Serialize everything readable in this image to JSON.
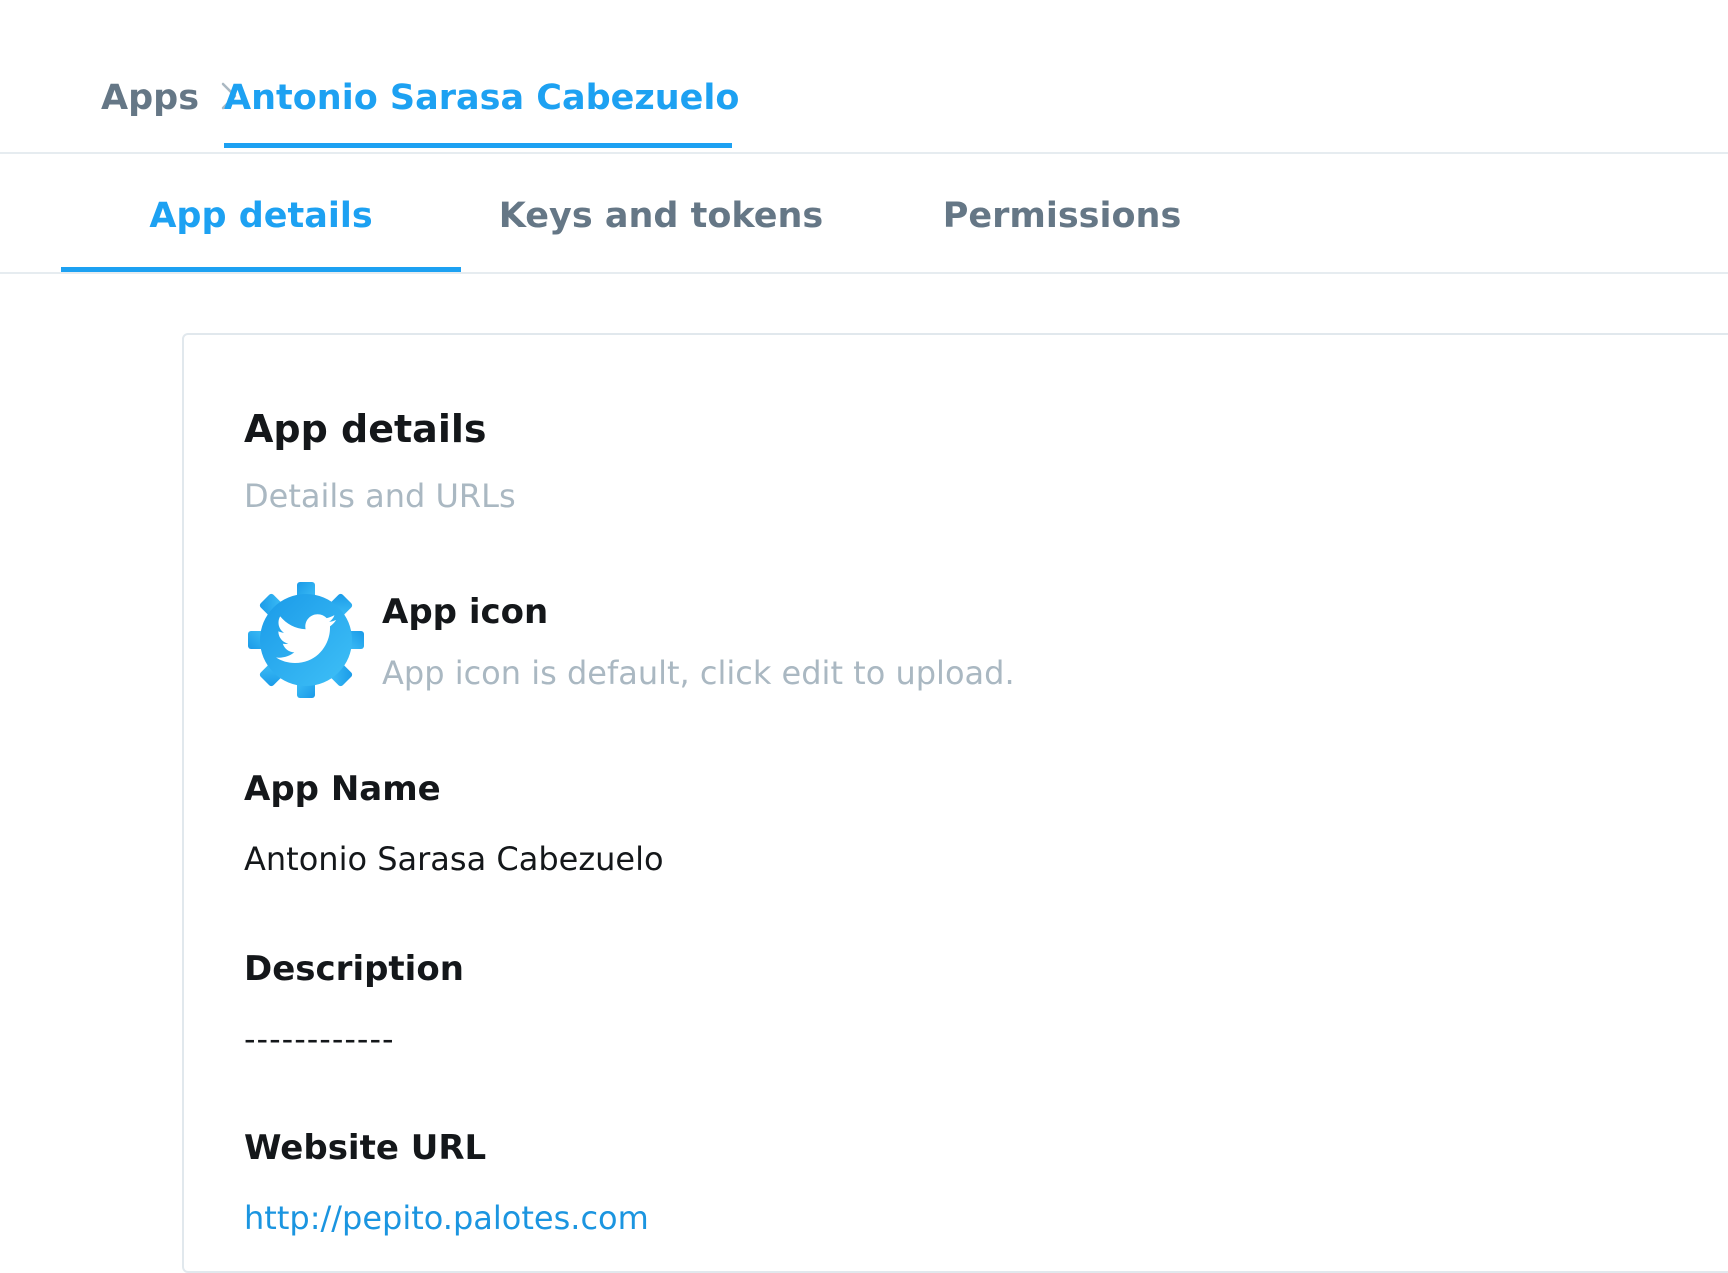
{
  "breadcrumb": {
    "root_label": "Apps",
    "current_label": "Antonio Sarasa Cabezuelo"
  },
  "tabs": [
    {
      "label": "App details",
      "active": true
    },
    {
      "label": "Keys and tokens",
      "active": false
    },
    {
      "label": "Permissions",
      "active": false
    }
  ],
  "card": {
    "title": "App details",
    "subtitle": "Details and URLs",
    "app_icon": {
      "label": "App icon",
      "hint": "App icon is default, click edit to upload.",
      "icon": "twitter-gear-icon"
    },
    "fields": {
      "app_name": {
        "label": "App Name",
        "value": "Antonio Sarasa Cabezuelo"
      },
      "description": {
        "label": "Description",
        "value": "------------"
      },
      "website_url": {
        "label": "Website URL",
        "value": "http://pepito.palotes.com"
      }
    }
  },
  "colors": {
    "accent": "#1da1f2",
    "link": "#1b95e0",
    "muted_text": "#aab8c2",
    "secondary_text": "#657786",
    "primary_text": "#14171a",
    "divider": "#e6ecf0"
  }
}
